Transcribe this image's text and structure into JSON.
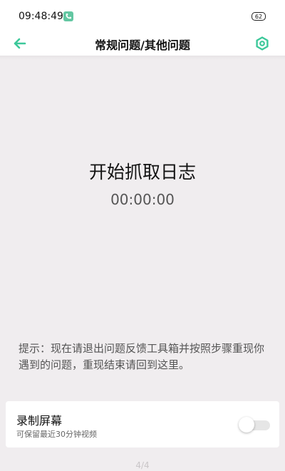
{
  "status_bar": {
    "time": "09:48:49",
    "call_icon": "phone-icon",
    "battery": "62"
  },
  "header": {
    "back_icon": "arrow-left-icon",
    "title": "常规问题/其他问题",
    "settings_icon": "hexagon-settings-icon",
    "accent_color": "#3cc89a"
  },
  "main": {
    "action_title": "开始抓取日志",
    "timer": "00:00:00",
    "hint": "提示：现在请退出问题反馈工具箱并按照步骤重现你遇到的问题，重现结束请回到这里。"
  },
  "record_screen": {
    "title": "录制屏幕",
    "subtitle": "可保留最近30分钟视频",
    "enabled": false
  },
  "page_indicator": "4/4"
}
